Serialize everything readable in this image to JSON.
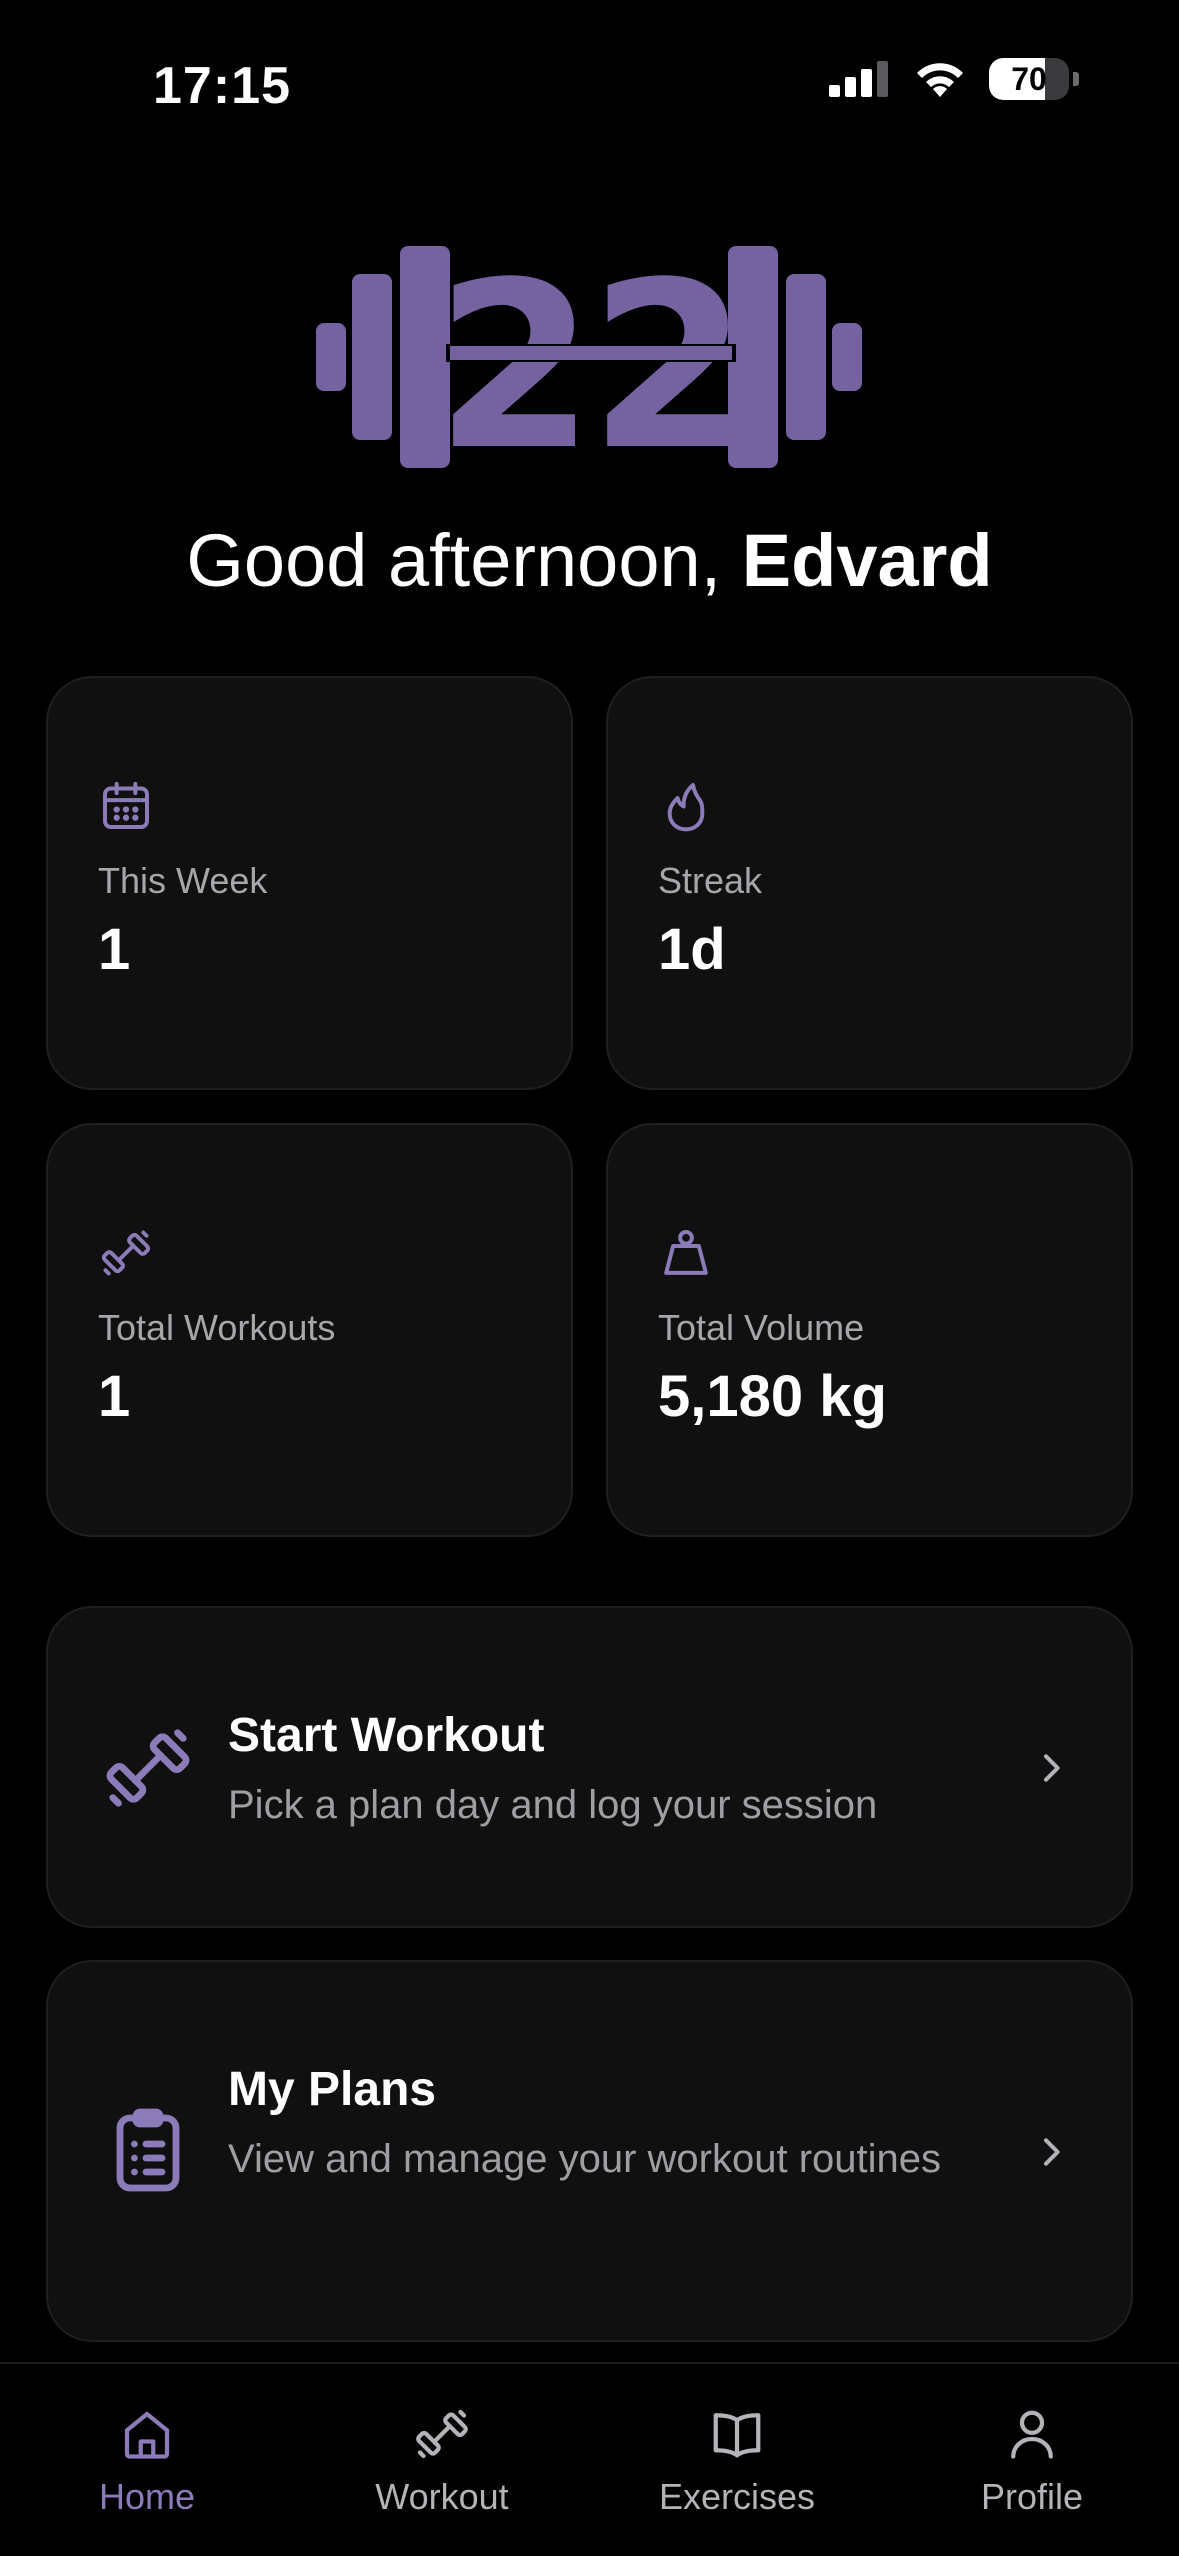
{
  "status_bar": {
    "time": "17:15",
    "battery": "70",
    "battery_level": 0.7
  },
  "logo": {
    "text": "22"
  },
  "greeting": {
    "prefix": "Good afternoon, ",
    "name": "Edvard"
  },
  "stats": [
    {
      "label": "This Week",
      "value": "1",
      "icon": "calendar-icon"
    },
    {
      "label": "Streak",
      "value": "1d",
      "icon": "flame-icon"
    },
    {
      "label": "Total Workouts",
      "value": "1",
      "icon": "dumbbell-icon"
    },
    {
      "label": "Total Volume",
      "value": "5,180 kg",
      "icon": "kettlebell-icon"
    }
  ],
  "actions": [
    {
      "title": "Start Workout",
      "subtitle": "Pick a plan day and log your session",
      "icon": "dumbbell-icon"
    },
    {
      "title": "My Plans",
      "subtitle": "View and manage your workout routines",
      "icon": "clipboard-icon"
    }
  ],
  "tabs": [
    {
      "label": "Home",
      "icon": "home-icon",
      "active": true
    },
    {
      "label": "Workout",
      "icon": "dumbbell-icon",
      "active": false
    },
    {
      "label": "Exercises",
      "icon": "book-icon",
      "active": false
    },
    {
      "label": "Profile",
      "icon": "user-icon",
      "active": false
    }
  ],
  "colors": {
    "accent": "#8b7bb8",
    "logo": "#7562a0",
    "background": "#000000",
    "card": "#101011"
  }
}
